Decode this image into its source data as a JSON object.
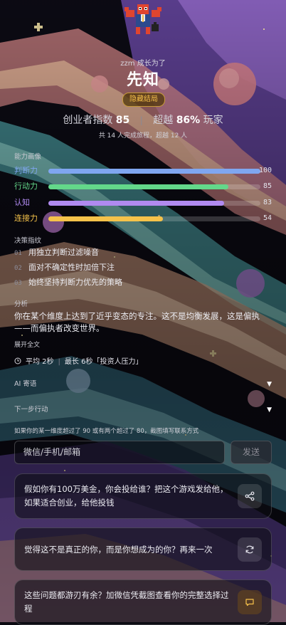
{
  "header": {
    "subtitle": "zzm 成长为了",
    "title": "先知",
    "badge": "隐藏结局"
  },
  "score": {
    "index_label": "创业者指数",
    "index_value": "85",
    "beat_label": "超越",
    "beat_value": "86%",
    "beat_suffix": "玩家",
    "separator": "|"
  },
  "journey_text": "共 14 人完成旅程，超越 12 人",
  "ability": {
    "label": "能力画像",
    "bars": [
      {
        "name": "判断力",
        "value": 100,
        "value_text": "100",
        "color": "#7fa6f0"
      },
      {
        "name": "行动力",
        "value": 85,
        "value_text": "85",
        "color": "#63d88a"
      },
      {
        "name": "认知",
        "value": 83,
        "value_text": "83",
        "color": "#b08af0"
      },
      {
        "name": "连接力",
        "value": 54,
        "value_text": "54",
        "color": "#f5c24a"
      }
    ]
  },
  "strategy": {
    "label": "决策指纹",
    "items": [
      {
        "num": "01",
        "text": "用独立判断过滤噪音"
      },
      {
        "num": "02",
        "text": "面对不确定性时加倍下注"
      },
      {
        "num": "03",
        "text": "始终坚持判断力优先的策略"
      }
    ]
  },
  "analysis": {
    "label": "分析",
    "text": "你在某个维度上达到了近乎变态的专注。这不是均衡发展，这是偏执——而偏执者改变世界。",
    "expand": "展开全文"
  },
  "timing": {
    "icon": "clock-icon",
    "avg": "平均 2秒",
    "separator": "|",
    "longest": "最长 6秒「投资人压力」"
  },
  "ai_message": {
    "label": "AI 寄语",
    "caret": "▼"
  },
  "next_action": {
    "label": "下一步行动",
    "caret": "▼"
  },
  "contact": {
    "condition": "如果你的某一维度超过了 90 或有两个超过了 80，截图填写联系方式",
    "placeholder": "微信/手机/邮箱",
    "send": "发送"
  },
  "cards": [
    {
      "text": "假如你有100万美金，你会投给谁？把这个游戏发给他，如果适合创业，给他投钱",
      "icon": "share-icon"
    },
    {
      "text": "觉得这不是真正的你，而是你想成为的你？再来一次",
      "icon": "restart-icon"
    },
    {
      "text": "这些问题都游刃有余？加微信凭截图查看你的完整选择过程",
      "icon": "chat-icon"
    }
  ],
  "colors": {
    "gold": "#f5c04a",
    "badge_border": "#c69a3a"
  }
}
